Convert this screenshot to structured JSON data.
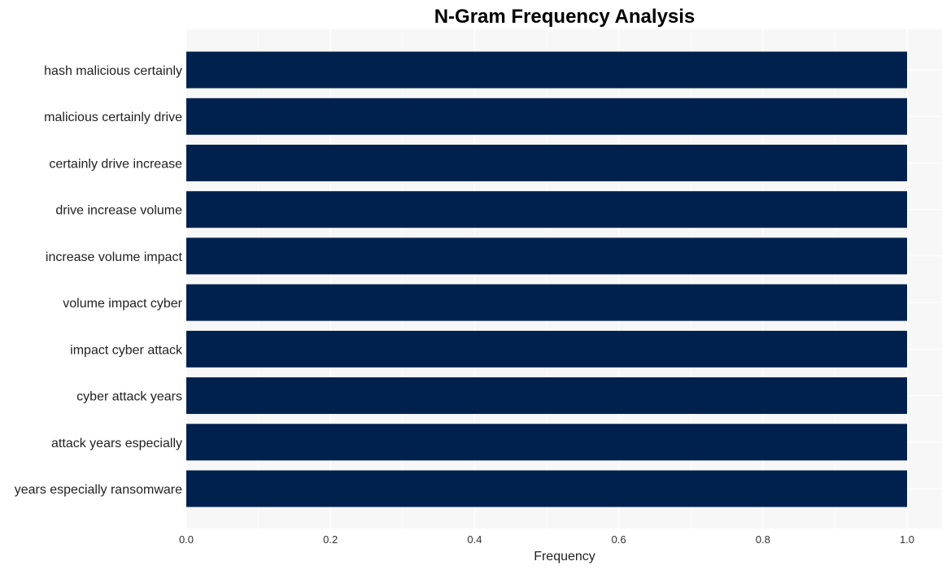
{
  "chart_data": {
    "type": "bar",
    "orientation": "horizontal",
    "title": "N-Gram Frequency Analysis",
    "xlabel": "Frequency",
    "ylabel": "",
    "categories": [
      "hash malicious certainly",
      "malicious certainly drive",
      "certainly drive increase",
      "drive increase volume",
      "increase volume impact",
      "volume impact cyber",
      "impact cyber attack",
      "cyber attack years",
      "attack years especially",
      "years especially ransomware"
    ],
    "values": [
      1,
      1,
      1,
      1,
      1,
      1,
      1,
      1,
      1,
      1
    ],
    "xlim": [
      0,
      1.05
    ],
    "xticks": [
      0.0,
      0.2,
      0.4,
      0.6,
      0.8,
      1.0
    ],
    "xtick_labels": [
      "0.0",
      "0.2",
      "0.4",
      "0.6",
      "0.8",
      "1.0"
    ],
    "grid": true,
    "legend": "none",
    "colors": {
      "bar": "#00214d",
      "panel_background": "#f7f7f7",
      "gridline": "#ffffff"
    }
  }
}
